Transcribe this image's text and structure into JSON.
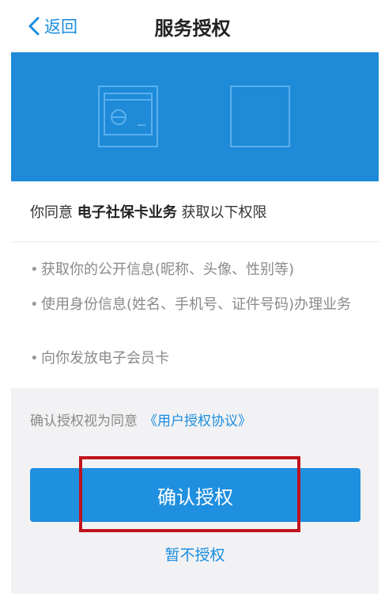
{
  "nav": {
    "back_label": "返回",
    "title": "服务授权"
  },
  "consent": {
    "prefix": "你同意 ",
    "service": "电子社保卡业务",
    "suffix": " 获取以下权限"
  },
  "permissions": [
    "获取你的公开信息(昵称、头像、性别等)",
    "使用身份信息(姓名、手机号、证件号码)办理业务",
    "向你发放电子会员卡"
  ],
  "agreement": {
    "text": "确认授权视为同意",
    "link": "《用户授权协议》"
  },
  "actions": {
    "confirm_label": "确认授权",
    "decline_label": "暂不授权"
  },
  "colors": {
    "accent": "#1a8de0",
    "hero_bg": "#1e8ad8",
    "highlight": "#c0131d"
  }
}
